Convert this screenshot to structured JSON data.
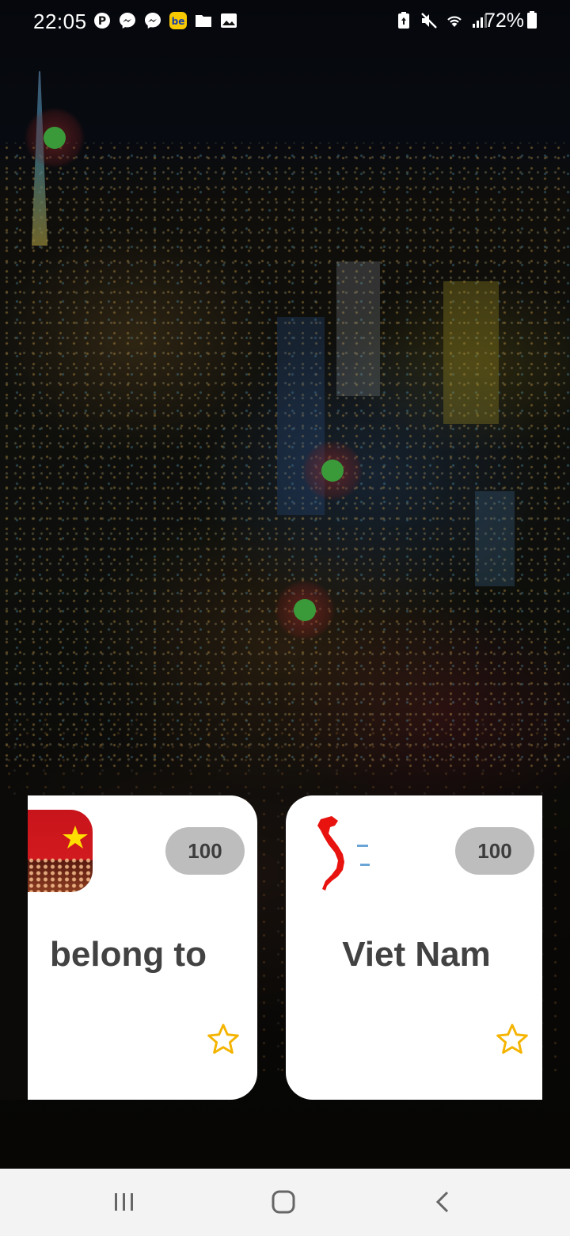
{
  "status_bar": {
    "time": "22:05",
    "battery_percent": "72%",
    "notification_icons": [
      "pinterest-icon",
      "messenger-icon",
      "messenger-icon",
      "be-app-icon",
      "folder-icon",
      "gallery-icon"
    ],
    "system_icons": [
      "battery-saver-icon",
      "mute-icon",
      "wifi-icon",
      "signal-icon",
      "battery-icon"
    ]
  },
  "cards": [
    {
      "score": "100",
      "word": "belong to",
      "thumbnail": "vietnam-flag-crowd-image",
      "favorite": false
    },
    {
      "score": "100",
      "word": "Viet Nam",
      "thumbnail": "vietnam-map-image",
      "favorite": false
    }
  ],
  "markers": 3,
  "colors": {
    "marker": "#3a9a3a",
    "star": "#f4b400",
    "score_pill": "#bdbdbd",
    "card_text": "#424242"
  },
  "nav_bar": [
    "recents-icon",
    "home-icon",
    "back-icon"
  ]
}
